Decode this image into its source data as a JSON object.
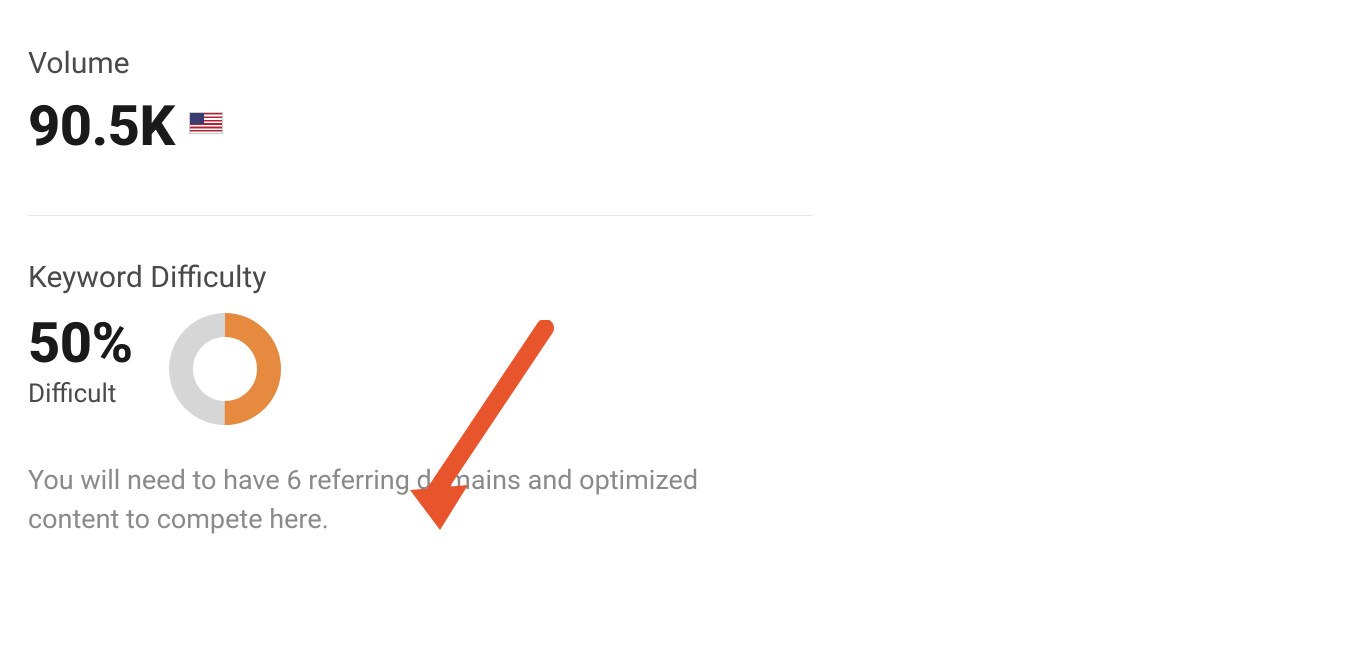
{
  "volume": {
    "label": "Volume",
    "value": "90.5K",
    "country_code": "us"
  },
  "difficulty": {
    "label": "Keyword Difficulty",
    "value": "50%",
    "percent_numeric": 50,
    "tier": "Difficult",
    "description": "You will need to have 6 referring domains and optimized content to compete here.",
    "colors": {
      "track": "#d6d6d6",
      "fill": "#e68a3f"
    }
  }
}
